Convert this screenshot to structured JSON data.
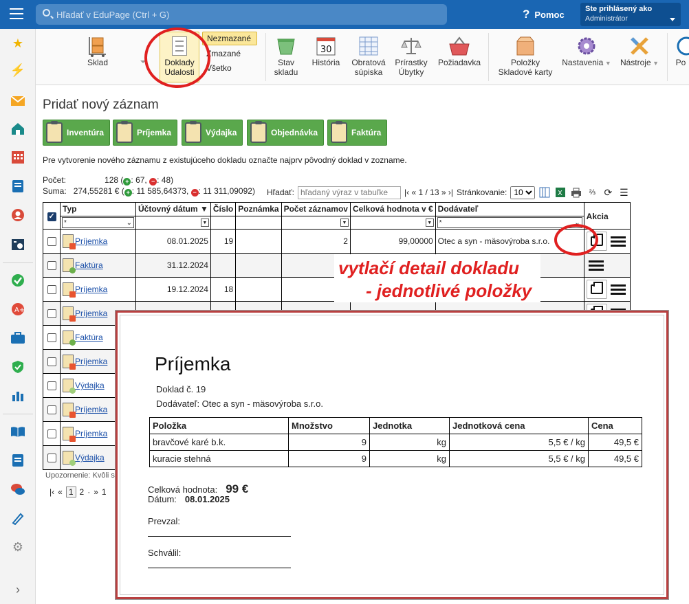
{
  "topbar": {
    "search_placeholder": "Hľadať v EduPage (Ctrl + G)",
    "help_label": "Pomoc",
    "user_line1": "Ste prihlásený ako",
    "user_line2": "Administrátor",
    "brand_color": "#1a66b3"
  },
  "ribbon": {
    "sklad": "Sklad",
    "doklady_line1": "Doklady",
    "doklady_line2": "Udalosti",
    "filters": [
      "Nezmazané",
      "Zmazané",
      "Všetko"
    ],
    "stav_line1": "Stav",
    "stav_line2": "skladu",
    "historia_day": "30",
    "historia": "História",
    "obratova_line1": "Obratová",
    "obratova_line2": "súpiska",
    "prirastky_line1": "Prírastky",
    "prirastky_line2": "Úbytky",
    "poziadavka": "Požiadavka",
    "polozky_line1": "Položky",
    "polozky_line2": "Skladové karty",
    "nastavenia": "Nastavenia",
    "nastroje": "Nástroje",
    "po": "Po"
  },
  "page": {
    "title": "Pridať nový záznam",
    "buttons": [
      "Inventúra",
      "Príjemka",
      "Výdajka",
      "Objednávka",
      "Faktúra"
    ],
    "info": "Pre vytvorenie nového záznamu z existujúceho dokladu označte najprv pôvodný doklad v zozname.",
    "count_label": "Počet:",
    "count_value": "128",
    "count_plus": "67,",
    "count_minus": "48)",
    "sum_label": "Suma:",
    "sum_value": "274,55281 €",
    "sum_plus": "11 585,64373,",
    "sum_minus": "11 311,09092)",
    "paren_open": "(",
    "search_label": "Hľadať:",
    "search_placeholder": "hľadaný výraz v tabuľke",
    "page_nav": "|‹ « 1 / 13 » ›|",
    "pagesize_label": "Stránkovanie:",
    "pagesize_value": "10",
    "warning": "Upozornenie: Kvôli st",
    "pager": [
      "|‹",
      "«",
      "1",
      "2",
      "·",
      "»",
      "1"
    ]
  },
  "table": {
    "headers": [
      "Typ",
      "Účtovný dátum ▼",
      "Číslo",
      "Poznámka",
      "Počet záznamov",
      "Celková hodnota v €",
      "Dodávateľ",
      "Akcia"
    ],
    "filter_star": "*",
    "rows": [
      {
        "type": "Príjemka",
        "date": "08.01.2025",
        "num": "19",
        "count": "2",
        "value": "99,00000",
        "supplier": "Otec a syn - mäsovýroba s.r.o."
      },
      {
        "type": "Faktúra",
        "date": "31.12.2024",
        "num": "",
        "count": "",
        "value": "",
        "supplier": ""
      },
      {
        "type": "Príjemka",
        "date": "19.12.2024",
        "num": "18",
        "count": "",
        "value": "",
        "supplier": ""
      },
      {
        "type": "Príjemka",
        "date": "",
        "num": "",
        "count": "",
        "value": "",
        "supplier": ""
      },
      {
        "type": "Faktúra",
        "date": "",
        "num": "",
        "count": "",
        "value": "",
        "supplier": ""
      },
      {
        "type": "Príjemka",
        "date": "",
        "num": "",
        "count": "",
        "value": "",
        "supplier": ""
      },
      {
        "type": "Výdajka",
        "date": "",
        "num": "",
        "count": "",
        "value": "",
        "supplier": ""
      },
      {
        "type": "Príjemka",
        "date": "",
        "num": "",
        "count": "",
        "value": "",
        "supplier": ""
      },
      {
        "type": "Príjemka",
        "date": "",
        "num": "",
        "count": "",
        "value": "",
        "supplier": ""
      },
      {
        "type": "Výdajka",
        "date": "",
        "num": "",
        "count": "",
        "value": "",
        "supplier": ""
      }
    ]
  },
  "annotation": {
    "line1": "vytlačí detail dokladu",
    "line2": "- jednotlivé položky"
  },
  "popup": {
    "title": "Príjemka",
    "doklad": "Doklad č.  19",
    "dodavatel": "Dodávateľ: Otec a syn - mäsovýroba s.r.o.",
    "headers": [
      "Položka",
      "Množstvo",
      "Jednotka",
      "Jednotková cena",
      "Cena"
    ],
    "rows": [
      {
        "item": "bravčové karé b.k.",
        "qty": "9",
        "unit": "kg",
        "price": "5,5 € / kg",
        "total": "49,5 €"
      },
      {
        "item": "kuracie stehná",
        "qty": "9",
        "unit": "kg",
        "price": "5,5 € / kg",
        "total": "49,5 €"
      }
    ],
    "total_label": "Celková hodnota:",
    "total_value": "99 €",
    "date_label": "Dátum:",
    "date_value": "08.01.2025",
    "prevzal": "Prevzal:",
    "schvalil": "Schválil:"
  }
}
